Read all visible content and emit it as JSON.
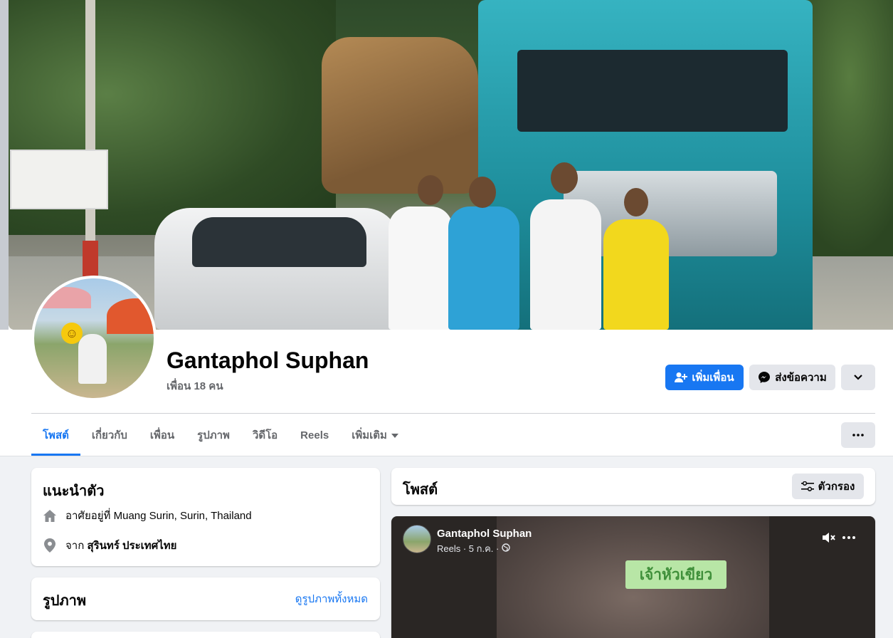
{
  "profile": {
    "name": "Gantaphol Suphan",
    "friends_count": "เพื่อน 18 คน"
  },
  "actions": {
    "add_friend": "เพิ่มเพื่อน",
    "message": "ส่งข้อความ"
  },
  "tabs": [
    {
      "label": "โพสต์",
      "active": true
    },
    {
      "label": "เกี่ยวกับ",
      "active": false
    },
    {
      "label": "เพื่อน",
      "active": false
    },
    {
      "label": "รูปภาพ",
      "active": false
    },
    {
      "label": "วิดีโอ",
      "active": false
    },
    {
      "label": "Reels",
      "active": false
    },
    {
      "label": "เพิ่มเติม",
      "active": false
    }
  ],
  "intro": {
    "title": "แนะนำตัว",
    "lives_prefix": "อาศัยอยู่ที่",
    "lives_value": "Muang Surin, Surin, Thailand",
    "from_prefix": "จาก",
    "from_value": "สุรินทร์ ประเทศไทย"
  },
  "photos": {
    "title": "รูปภาพ",
    "see_all": "ดูรูปภาพทั้งหมด"
  },
  "posts": {
    "title": "โพสต์",
    "filter_label": "ตัวกรอง"
  },
  "reel_post": {
    "author": "Gantaphol Suphan",
    "meta": "Reels · 5 ก.ค. ·",
    "caption": "เจ้าหัวเขียว"
  },
  "colors": {
    "accent": "#1877f2",
    "page_bg": "#f0f2f5",
    "secondary_button": "#e4e6eb"
  },
  "icons": [
    "add-friend-icon",
    "messenger-icon",
    "chevron-down-icon",
    "more-dots-icon",
    "home-icon",
    "location-pin-icon",
    "filter-icon",
    "mute-icon",
    "globe-icon"
  ]
}
